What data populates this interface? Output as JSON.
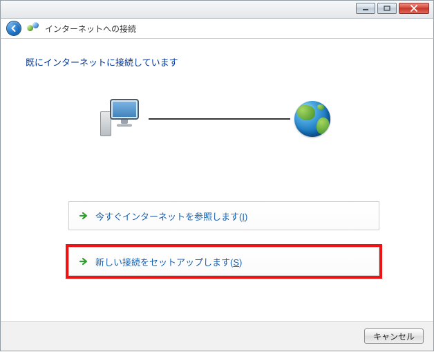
{
  "header": {
    "title": "インターネットへの接続"
  },
  "status_message": "既にインターネットに接続しています",
  "options": [
    {
      "label": "今すぐインターネットを参照します(",
      "key": "I",
      "suffix": ")",
      "highlight": false
    },
    {
      "label": "新しい接続をセットアップします(",
      "key": "S",
      "suffix": ")",
      "highlight": true
    }
  ],
  "buttons": {
    "cancel": "キャンセル"
  }
}
